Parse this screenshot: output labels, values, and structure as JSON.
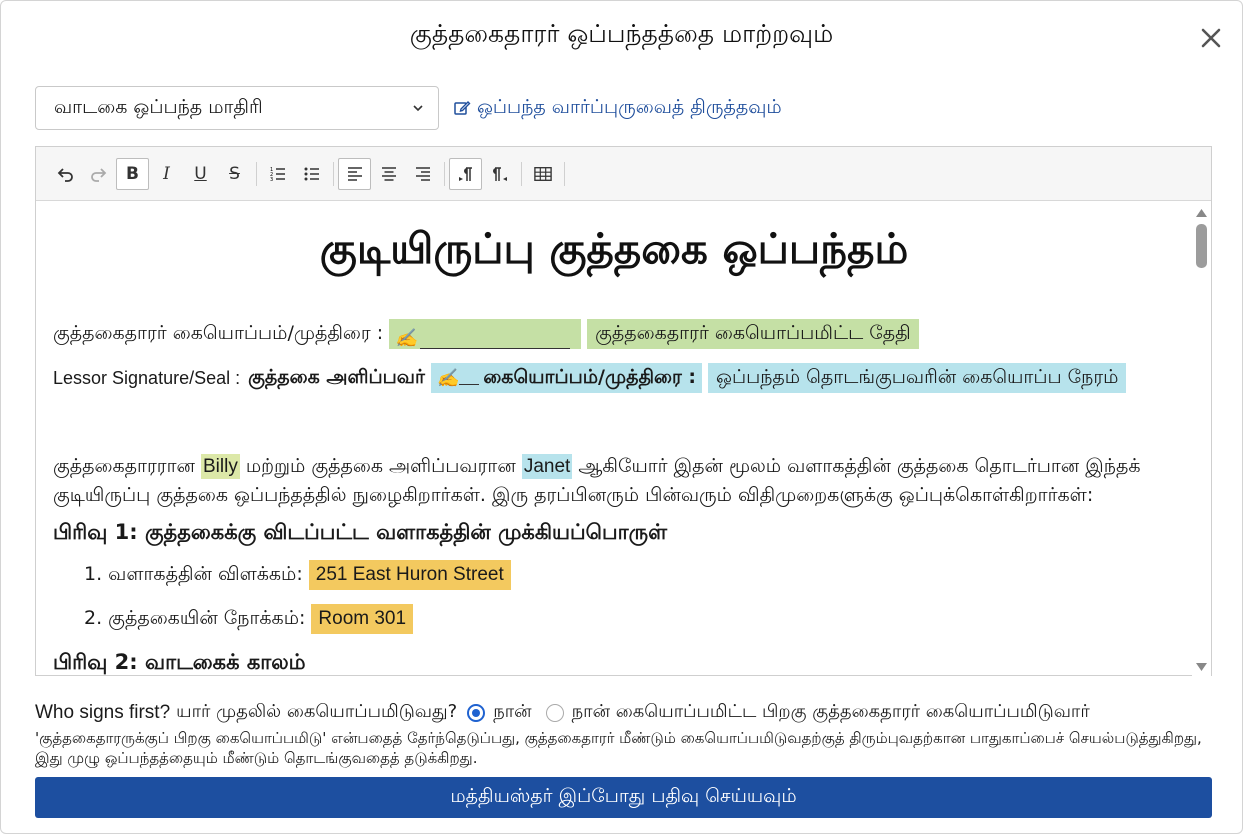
{
  "dialog": {
    "title": "குத்தகைதாரர் ஒப்பந்தத்தை மாற்றவும்"
  },
  "template_select": {
    "selected": "வாடகை ஒப்பந்த மாதிரி"
  },
  "edit_template_link": "ஒப்பந்த வார்ப்புருவைத் திருத்தவும்",
  "toolbar": {
    "bold": "B",
    "italic": "I",
    "underline": "U",
    "strike": "S"
  },
  "document": {
    "title": "குடியிருப்பு குத்தகை ஒப்பந்தம்",
    "tenant_sig_label": "குத்தகைதாரர் கையொப்பம்/முத்திரை :",
    "tenant_sig_glyph": "✍",
    "tenant_sig_date": "குத்தகைதாரர் கையொப்பமிட்ட தேதி",
    "lessor_label": "Lessor Signature/Seal :",
    "lessor_bold": "குத்தகை அளிப்பவர்",
    "lessor_sig_glyph": "✍",
    "lessor_sig_field": "கையொப்பம்/முத்திரை :",
    "lessor_sig_time": "ஒப்பந்தம் தொடங்குபவரின் கையொப்ப நேரம்",
    "intro_1": "குத்தகைதாரரான",
    "tenant_name": "Billy",
    "intro_2": "மற்றும் குத்தகை அளிப்பவரான",
    "lessor_name": "Janet",
    "intro_3": "ஆகியோர் இதன் மூலம் வளாகத்தின் குத்தகை தொடர்பான இந்தக் குடியிருப்பு குத்தகை ஒப்பந்தத்தில் நுழைகிறார்கள். இரு தரப்பினரும் பின்வரும் விதிமுறைகளுக்கு ஒப்புக்கொள்கிறார்கள்:",
    "section1": "பிரிவு 1: குத்தகைக்கு விடப்பட்ட வளாகத்தின் முக்கியப்பொருள்",
    "item1_label": "1. வளாகத்தின் விளக்கம்:",
    "item1_value": "251 East Huron Street",
    "item2_label": "2. குத்தகையின் நோக்கம்:",
    "item2_value": "Room 301",
    "section2": "பிரிவு 2: வாடகைக் காலம்"
  },
  "signing": {
    "question_en": "Who signs first?",
    "question_ta": "யார் முதலில் கையொப்பமிடுவது?",
    "option_me": "நான்",
    "option_after": "நான் கையொப்பமிட்ட பிறகு குத்தகைதாரர் கையொப்பமிடுவார்",
    "note": "'குத்தகைதாரருக்குப் பிறகு கையொப்பமிடு' என்பதைத் தேர்ந்தெடுப்பது, குத்தகைதாரர் மீண்டும் கையொப்பமிடுவதற்குத் திரும்புவதற்கான பாதுகாப்பைச் செயல்படுத்துகிறது, இது முழு ஒப்பந்தத்தையும் மீண்டும் தொடங்குவதைத் தடுக்கிறது."
  },
  "submit_label": "மத்தியஸ்தர் இப்போது பதிவு செய்யவும்",
  "colors": {
    "primary": "#1d4fa0",
    "link": "#1f4e9c",
    "highlight_green": "#c5e0a5",
    "highlight_cyan": "#b7e3ec",
    "highlight_yellow": "#f3c95f"
  }
}
